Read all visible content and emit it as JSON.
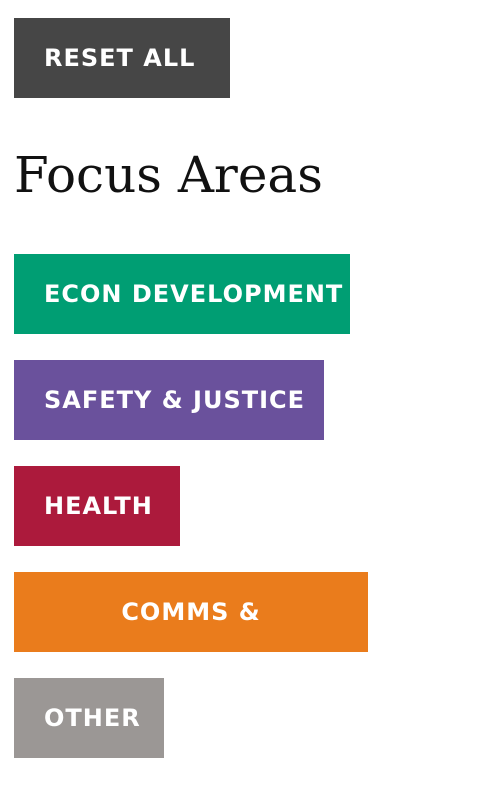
{
  "toolbar": {
    "reset_label": "RESET ALL",
    "reset_color": "#464646"
  },
  "section": {
    "title": "Focus Areas"
  },
  "focus_areas": [
    {
      "label": "ECON DEVELOPMENT",
      "color": "#009E73"
    },
    {
      "label": "SAFETY & JUSTICE",
      "color": "#6A519C"
    },
    {
      "label": "HEALTH",
      "color": "#AC1A3C"
    },
    {
      "label": "COMMS &",
      "color": "#EA7C1C"
    },
    {
      "label": "OTHER",
      "color": "#9B9795"
    }
  ]
}
